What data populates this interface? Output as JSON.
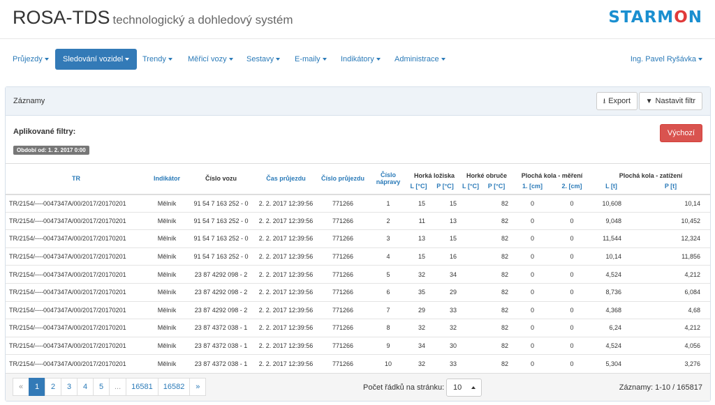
{
  "header": {
    "app_title": "ROSA-TDS",
    "app_subtitle": "technologický a dohledový systém",
    "logo_prefix": "STARM",
    "logo_o": "O",
    "logo_suffix": "N"
  },
  "nav": {
    "items": [
      "Průjezdy",
      "Sledování vozidel",
      "Trendy",
      "Měřicí vozy",
      "Sestavy",
      "E-maily",
      "Indikátory",
      "Administrace"
    ],
    "active_index": 1,
    "user": "Ing. Pavel Ryšávka"
  },
  "panel": {
    "title": "Záznamy",
    "export_label": "Export",
    "filter_label": "Nastavit filtr",
    "applied_filters_label": "Aplikované filtry:",
    "filter_badge": "Období od: 1. 2. 2017 0:00",
    "default_label": "Výchozí"
  },
  "table": {
    "headers": {
      "tr": "TR",
      "indicator": "Indikátor",
      "car": "Číslo vozu",
      "time": "Čas průjezdu",
      "pass": "Číslo průjezdu",
      "axle": "Číslo nápravy",
      "hot_bearings": "Horká ložiska",
      "hot_rims": "Horké obruče",
      "flat_meas": "Plochá kola - měření",
      "flat_load": "Plochá kola - zatížení"
    },
    "subheaders": [
      "L [°C]",
      "P [°C]",
      "L [°C]",
      "P [°C]",
      "1. [cm]",
      "2. [cm]",
      "L [t]",
      "P [t]"
    ],
    "rows": [
      [
        "TR/2154/----0047347A/00/2017/20170201",
        "Mělník",
        "91 54 7 163 252 - 0",
        "2. 2. 2017 12:39:56",
        "771266",
        "1",
        "15",
        "15",
        "",
        "82",
        "0",
        "0",
        "10,608",
        "10,14"
      ],
      [
        "TR/2154/----0047347A/00/2017/20170201",
        "Mělník",
        "91 54 7 163 252 - 0",
        "2. 2. 2017 12:39:56",
        "771266",
        "2",
        "11",
        "13",
        "",
        "82",
        "0",
        "0",
        "9,048",
        "10,452"
      ],
      [
        "TR/2154/----0047347A/00/2017/20170201",
        "Mělník",
        "91 54 7 163 252 - 0",
        "2. 2. 2017 12:39:56",
        "771266",
        "3",
        "13",
        "15",
        "",
        "82",
        "0",
        "0",
        "11,544",
        "12,324"
      ],
      [
        "TR/2154/----0047347A/00/2017/20170201",
        "Mělník",
        "91 54 7 163 252 - 0",
        "2. 2. 2017 12:39:56",
        "771266",
        "4",
        "15",
        "16",
        "",
        "82",
        "0",
        "0",
        "10,14",
        "11,856"
      ],
      [
        "TR/2154/----0047347A/00/2017/20170201",
        "Mělník",
        "23 87 4292 098 - 2",
        "2. 2. 2017 12:39:56",
        "771266",
        "5",
        "32",
        "34",
        "",
        "82",
        "0",
        "0",
        "4,524",
        "4,212"
      ],
      [
        "TR/2154/----0047347A/00/2017/20170201",
        "Mělník",
        "23 87 4292 098 - 2",
        "2. 2. 2017 12:39:56",
        "771266",
        "6",
        "35",
        "29",
        "",
        "82",
        "0",
        "0",
        "8,736",
        "6,084"
      ],
      [
        "TR/2154/----0047347A/00/2017/20170201",
        "Mělník",
        "23 87 4292 098 - 2",
        "2. 2. 2017 12:39:56",
        "771266",
        "7",
        "29",
        "33",
        "",
        "82",
        "0",
        "0",
        "4,368",
        "4,68"
      ],
      [
        "TR/2154/----0047347A/00/2017/20170201",
        "Mělník",
        "23 87 4372 038 - 1",
        "2. 2. 2017 12:39:56",
        "771266",
        "8",
        "32",
        "32",
        "",
        "82",
        "0",
        "0",
        "6,24",
        "4,212"
      ],
      [
        "TR/2154/----0047347A/00/2017/20170201",
        "Mělník",
        "23 87 4372 038 - 1",
        "2. 2. 2017 12:39:56",
        "771266",
        "9",
        "34",
        "30",
        "",
        "82",
        "0",
        "0",
        "4,524",
        "4,056"
      ],
      [
        "TR/2154/----0047347A/00/2017/20170201",
        "Mělník",
        "23 87 4372 038 - 1",
        "2. 2. 2017 12:39:56",
        "771266",
        "10",
        "32",
        "33",
        "",
        "82",
        "0",
        "0",
        "5,304",
        "3,276"
      ]
    ]
  },
  "footer": {
    "pages": [
      "«",
      "1",
      "2",
      "3",
      "4",
      "5",
      "...",
      "16581",
      "16582",
      "»"
    ],
    "active_page": "1",
    "rows_label": "Počet řádků na stránku:",
    "rows_value": "10",
    "records": "Záznamy: 1-10 / 165817"
  },
  "colors": {
    "primary": "#337ab7",
    "link": "#2a7ab8",
    "danger": "#d9534f",
    "logo_blue": "#1a8fd0",
    "logo_red": "#e03a3a"
  }
}
